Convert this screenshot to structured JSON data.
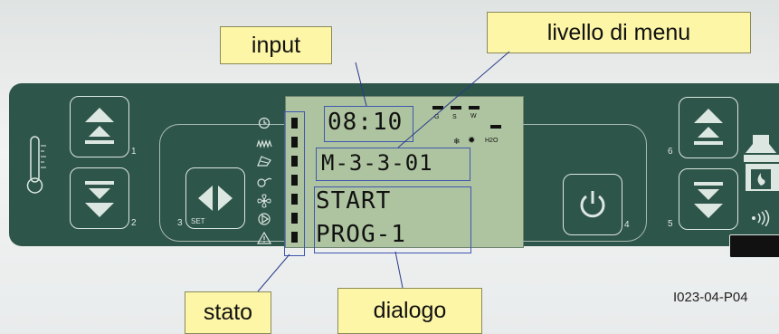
{
  "callouts": {
    "input": "input",
    "livello_di_menu": "livello di menu",
    "stato": "stato",
    "dialogo": "dialogo"
  },
  "display": {
    "time": "08:10",
    "menu_code": "M-3-3-01",
    "line1": "START",
    "line2": "PROG-1",
    "indicators": [
      "G",
      "S",
      "W",
      "H2O"
    ]
  },
  "buttons": {
    "b1": "1",
    "b2": "2",
    "b3": "3",
    "set": "SET",
    "b4": "4",
    "b5": "5",
    "b6": "6"
  },
  "status_icons": [
    "clock-icon",
    "heater-icon",
    "fuel-icon",
    "pump-icon",
    "fan-icon",
    "flow-icon",
    "warning-icon"
  ],
  "figure_code": "I023-04-P04",
  "colors": {
    "panel": "#2e5549",
    "lcd": "#aec4a0",
    "callout": "#fdf6a6",
    "leader": "#2a3b8a"
  }
}
